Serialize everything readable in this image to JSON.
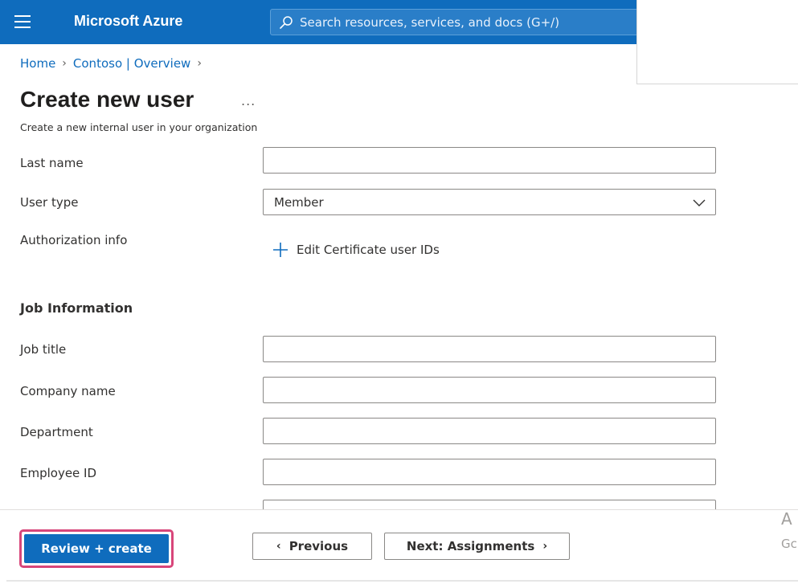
{
  "header": {
    "brand": "Microsoft Azure",
    "search_placeholder": "Search resources, services, and docs (G+/)",
    "accent_color": "#0f6cbd"
  },
  "breadcrumb": [
    {
      "label": "Home"
    },
    {
      "label": "Contoso | Overview"
    }
  ],
  "page": {
    "title": "Create new user",
    "more_icon": "...",
    "subtitle": "Create a new internal user in your organization"
  },
  "form": {
    "last_name_label": "Last name",
    "user_type_label": "User type",
    "user_type_value": "Member",
    "authorization_label": "Authorization info",
    "edit_cert_link": "Edit Certificate user IDs",
    "job_section": "Job Information",
    "job_title_label": "Job title",
    "company_label": "Company name",
    "department_label": "Department",
    "employee_id_label": "Employee ID"
  },
  "footer": {
    "review_create": "Review + create",
    "previous": "Previous",
    "next": "Next: Assignments",
    "highlight_color": "#d8467a"
  },
  "watermark": {
    "line1": "A",
    "line2": "Gc"
  }
}
